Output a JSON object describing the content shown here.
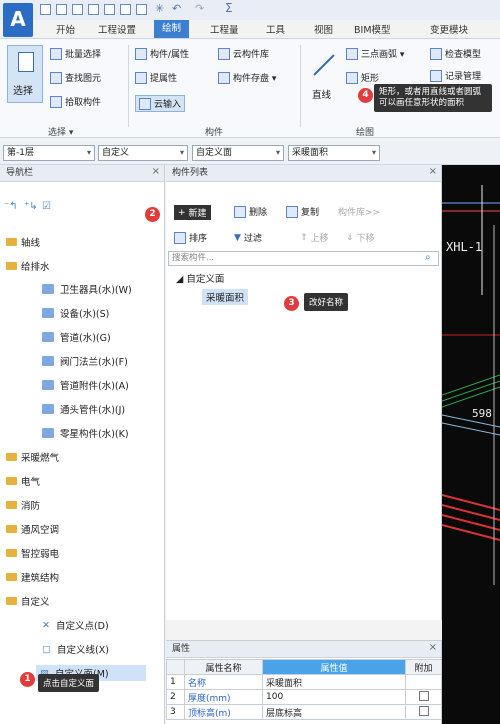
{
  "tabs": [
    "开始",
    "工程设置",
    "绘制",
    "工程量",
    "工具",
    "视图",
    "BIM模型",
    "变更模块"
  ],
  "active_tab": "绘制",
  "ribbon": {
    "select_label": "选择",
    "batch_select": "批量选择",
    "find_element": "查找图元",
    "pick_component": "拾取构件",
    "group_select": "选择 ▾",
    "component_attr": "构件/属性",
    "extract_attr": "提属性",
    "cloud_input": "云输入",
    "cloud_library": "云构件库",
    "component_save": "构件存盘 ▾",
    "group_component": "构件",
    "line": "直线",
    "three_point_arc": "三点画弧 ▾",
    "rectangle": "矩形",
    "group_draw": "绘图",
    "check_model": "检查模型",
    "record_manage": "记录管理"
  },
  "selectors": [
    "第-1层",
    "自定义",
    "自定义面",
    "采暖面积"
  ],
  "nav": {
    "title": "导航栏",
    "folders_top": [
      "轴线",
      "给排水"
    ],
    "water_items": [
      "卫生器具(水)(W)",
      "设备(水)(S)",
      "管道(水)(G)",
      "阀门法兰(水)(F)",
      "管道附件(水)(A)",
      "通头管件(水)(J)",
      "零星构件(水)(K)"
    ],
    "folders_mid": [
      "采暖燃气",
      "电气",
      "消防",
      "通风空调",
      "智控弱电",
      "建筑结构",
      "自定义"
    ],
    "custom_items": [
      "自定义点(D)",
      "自定义线(X)",
      "自定义面(M)"
    ]
  },
  "component_list": {
    "title": "构件列表",
    "new": "新建",
    "delete": "删除",
    "copy": "复制",
    "library": "构件库>>",
    "sort": "排序",
    "filter": "过滤",
    "move_up": "上移",
    "move_down": "下移",
    "search_placeholder": "搜索构件...",
    "tree_root": "自定义面",
    "tree_child": "采暖面积"
  },
  "properties": {
    "title": "属性",
    "headers": [
      "属性名称",
      "属性值",
      "附加"
    ],
    "rows": [
      {
        "no": "1",
        "name": "名称",
        "value": "采暖面积"
      },
      {
        "no": "2",
        "name": "厚度(mm)",
        "value": "100"
      },
      {
        "no": "3",
        "name": "顶标高(m)",
        "value": "层底标高"
      }
    ]
  },
  "cad": {
    "label1": "XHL-1",
    "label2": "598"
  },
  "annotations": [
    {
      "no": "1",
      "text": "点击自定义面"
    },
    {
      "no": "2",
      "text": "新建"
    },
    {
      "no": "3",
      "text": "改好名称"
    },
    {
      "no": "4",
      "text": "矩形，或者用直线或者圆弧可以画任意形状的面积"
    }
  ],
  "colors": {
    "accent": "#3c7fd1",
    "badge": "#e23b3b",
    "highlight": "#4aa3e8"
  }
}
